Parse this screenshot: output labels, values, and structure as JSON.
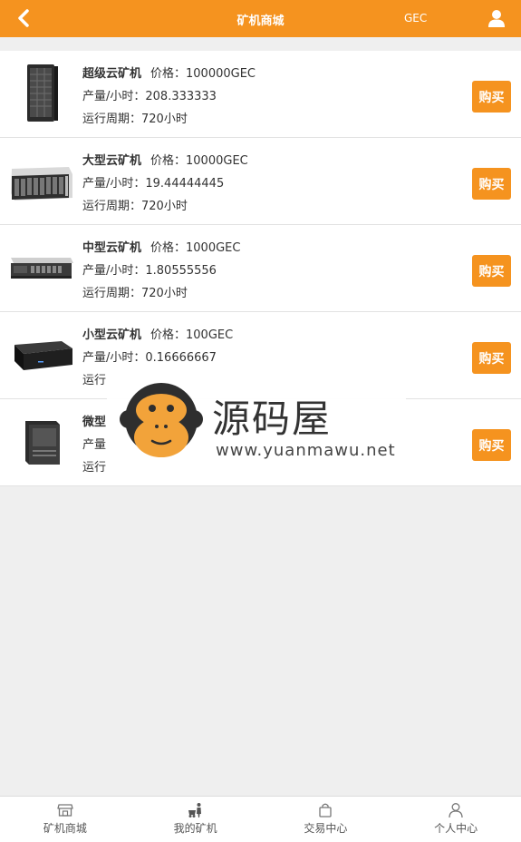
{
  "header": {
    "title": "矿机商城",
    "unit": "GEC",
    "back_icon": "chevron-left-icon",
    "user_icon": "user-icon",
    "background": "#f5931f"
  },
  "products": [
    {
      "name": "超级云矿机",
      "price": "价格：100000GEC",
      "output": "产量/小时：208.333333",
      "cycle": "运行周期：720小时",
      "buy": "购买"
    },
    {
      "name": "大型云矿机",
      "price": "价格：10000GEC",
      "output": "产量/小时：19.44444445",
      "cycle": "运行周期：720小时",
      "buy": "购买"
    },
    {
      "name": "中型云矿机",
      "price": "价格：1000GEC",
      "output": "产量/小时：1.80555556",
      "cycle": "运行周期：720小时",
      "buy": "购买"
    },
    {
      "name": "小型云矿机",
      "price": "价格：100GEC",
      "output": "产量/小时：0.16666667",
      "cycle": "运行",
      "buy": "购买"
    },
    {
      "name": "微型",
      "price": "",
      "output": "产量",
      "cycle": "运行",
      "buy": "购买"
    }
  ],
  "watermark": {
    "title": "源码屋",
    "url": "www.yuanmawu.net"
  },
  "tabbar": [
    {
      "label": "矿机商城",
      "icon": "store-icon"
    },
    {
      "label": "我的矿机",
      "icon": "miner-icon"
    },
    {
      "label": "交易中心",
      "icon": "bag-icon"
    },
    {
      "label": "个人中心",
      "icon": "person-icon"
    }
  ]
}
